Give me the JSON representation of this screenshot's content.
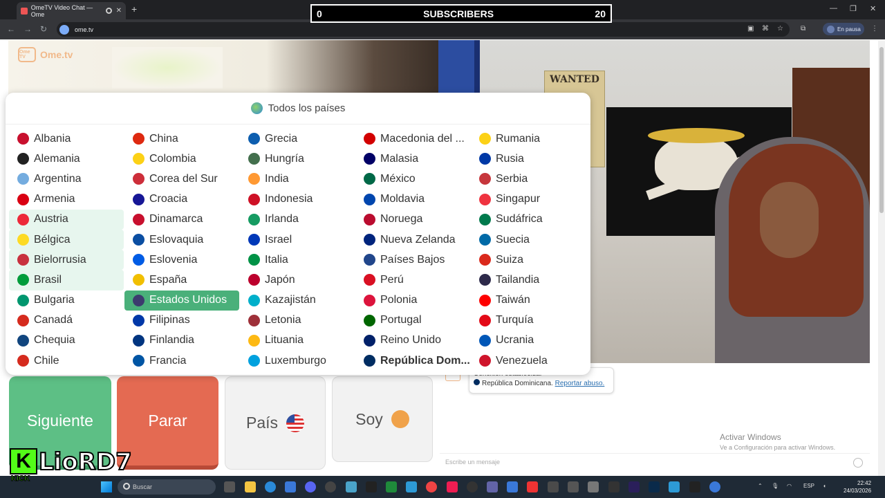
{
  "browser": {
    "tab_title": "OmeTV Video Chat — Ome",
    "new_tab": "+",
    "url": "ome.tv",
    "profile_status": "En pausa",
    "window_controls": [
      "—",
      "❐",
      "✕"
    ]
  },
  "stream_overlay": {
    "subs_current": "0",
    "subs_label": "SUBSCRIBERS",
    "subs_goal": "20",
    "streamer_initial": "K",
    "streamer_name": "LioRD7",
    "platform": "KICK"
  },
  "app": {
    "logo_badge": "Ome TV",
    "logo_text": "Ome.tv"
  },
  "video_right": {
    "poster_text": "WANTED"
  },
  "country_panel": {
    "title": "Todos los países",
    "columns": [
      [
        {
          "name": "Albania",
          "flag": "#c8102e",
          "state": ""
        },
        {
          "name": "Alemania",
          "flag": "#222222",
          "state": ""
        },
        {
          "name": "Argentina",
          "flag": "#74acdf",
          "state": ""
        },
        {
          "name": "Armenia",
          "flag": "#d90012",
          "state": ""
        },
        {
          "name": "Austria",
          "flag": "#ed2939",
          "state": "sel"
        },
        {
          "name": "Bélgica",
          "flag": "#fdda24",
          "state": "sel"
        },
        {
          "name": "Bielorrusia",
          "flag": "#c8313e",
          "state": "sel"
        },
        {
          "name": "Brasil",
          "flag": "#009c3b",
          "state": "sel"
        },
        {
          "name": "Bulgaria",
          "flag": "#00966e",
          "state": ""
        },
        {
          "name": "Canadá",
          "flag": "#d52b1e",
          "state": ""
        },
        {
          "name": "Chequia",
          "flag": "#11457e",
          "state": ""
        },
        {
          "name": "Chile",
          "flag": "#d52b1e",
          "state": ""
        }
      ],
      [
        {
          "name": "China",
          "flag": "#de2910",
          "state": ""
        },
        {
          "name": "Colombia",
          "flag": "#fcd116",
          "state": ""
        },
        {
          "name": "Corea del Sur",
          "flag": "#cd2e3a",
          "state": ""
        },
        {
          "name": "Croacia",
          "flag": "#171796",
          "state": ""
        },
        {
          "name": "Dinamarca",
          "flag": "#c8102e",
          "state": ""
        },
        {
          "name": "Eslovaquia",
          "flag": "#0b4ea2",
          "state": ""
        },
        {
          "name": "Eslovenia",
          "flag": "#005ce5",
          "state": ""
        },
        {
          "name": "España",
          "flag": "#f1bf00",
          "state": ""
        },
        {
          "name": "Estados Unidos",
          "flag": "#3c3b6e",
          "state": "active"
        },
        {
          "name": "Filipinas",
          "flag": "#0038a8",
          "state": ""
        },
        {
          "name": "Finlandia",
          "flag": "#003580",
          "state": ""
        },
        {
          "name": "Francia",
          "flag": "#0055a4",
          "state": ""
        }
      ],
      [
        {
          "name": "Grecia",
          "flag": "#0d5eaf",
          "state": ""
        },
        {
          "name": "Hungría",
          "flag": "#436f4d",
          "state": ""
        },
        {
          "name": "India",
          "flag": "#ff9933",
          "state": ""
        },
        {
          "name": "Indonesia",
          "flag": "#ce1126",
          "state": ""
        },
        {
          "name": "Irlanda",
          "flag": "#169b62",
          "state": ""
        },
        {
          "name": "Israel",
          "flag": "#0038b8",
          "state": ""
        },
        {
          "name": "Italia",
          "flag": "#009246",
          "state": ""
        },
        {
          "name": "Japón",
          "flag": "#bc002d",
          "state": ""
        },
        {
          "name": "Kazajistán",
          "flag": "#00afca",
          "state": ""
        },
        {
          "name": "Letonia",
          "flag": "#9e3039",
          "state": ""
        },
        {
          "name": "Lituania",
          "flag": "#fdb913",
          "state": ""
        },
        {
          "name": "Luxemburgo",
          "flag": "#00a1de",
          "state": ""
        }
      ],
      [
        {
          "name": "Macedonia del ...",
          "flag": "#d20000",
          "state": ""
        },
        {
          "name": "Malasia",
          "flag": "#010066",
          "state": ""
        },
        {
          "name": "México",
          "flag": "#006847",
          "state": ""
        },
        {
          "name": "Moldavia",
          "flag": "#0046ae",
          "state": ""
        },
        {
          "name": "Noruega",
          "flag": "#ba0c2f",
          "state": ""
        },
        {
          "name": "Nueva Zelanda",
          "flag": "#00247d",
          "state": ""
        },
        {
          "name": "Países Bajos",
          "flag": "#21468b",
          "state": ""
        },
        {
          "name": "Perú",
          "flag": "#d91023",
          "state": ""
        },
        {
          "name": "Polonia",
          "flag": "#dc143c",
          "state": ""
        },
        {
          "name": "Portugal",
          "flag": "#006600",
          "state": ""
        },
        {
          "name": "Reino Unido",
          "flag": "#012169",
          "state": ""
        },
        {
          "name": "República Dom...",
          "flag": "#002d62",
          "state": "bold"
        }
      ],
      [
        {
          "name": "Rumania",
          "flag": "#fcd116",
          "state": ""
        },
        {
          "name": "Rusia",
          "flag": "#0039a6",
          "state": ""
        },
        {
          "name": "Serbia",
          "flag": "#c6363c",
          "state": ""
        },
        {
          "name": "Singapur",
          "flag": "#ef3340",
          "state": ""
        },
        {
          "name": "Sudáfrica",
          "flag": "#007a4d",
          "state": ""
        },
        {
          "name": "Suecia",
          "flag": "#006aa7",
          "state": ""
        },
        {
          "name": "Suiza",
          "flag": "#da291c",
          "state": ""
        },
        {
          "name": "Tailandia",
          "flag": "#2d2a4a",
          "state": ""
        },
        {
          "name": "Taiwán",
          "flag": "#fe0000",
          "state": ""
        },
        {
          "name": "Turquía",
          "flag": "#e30a17",
          "state": ""
        },
        {
          "name": "Ucrania",
          "flag": "#0057b7",
          "state": ""
        },
        {
          "name": "Venezuela",
          "flag": "#cf142b",
          "state": ""
        }
      ]
    ]
  },
  "controls": {
    "next_label": "Siguiente",
    "stop_label": "Parar",
    "country_label": "País",
    "gender_label": "Soy"
  },
  "chat": {
    "status_line": "Conexión establecida.",
    "country_line": "República Dominicana.",
    "report_link": "Reportar abuso.",
    "input_placeholder": "Escribe un mensaje"
  },
  "windows_watermark": {
    "title": "Activar Windows",
    "subtitle": "Ve a Configuración para activar Windows."
  },
  "taskbar": {
    "search_placeholder": "Buscar",
    "language": "ESP",
    "time": "22:42",
    "date": "24/03/2026"
  }
}
